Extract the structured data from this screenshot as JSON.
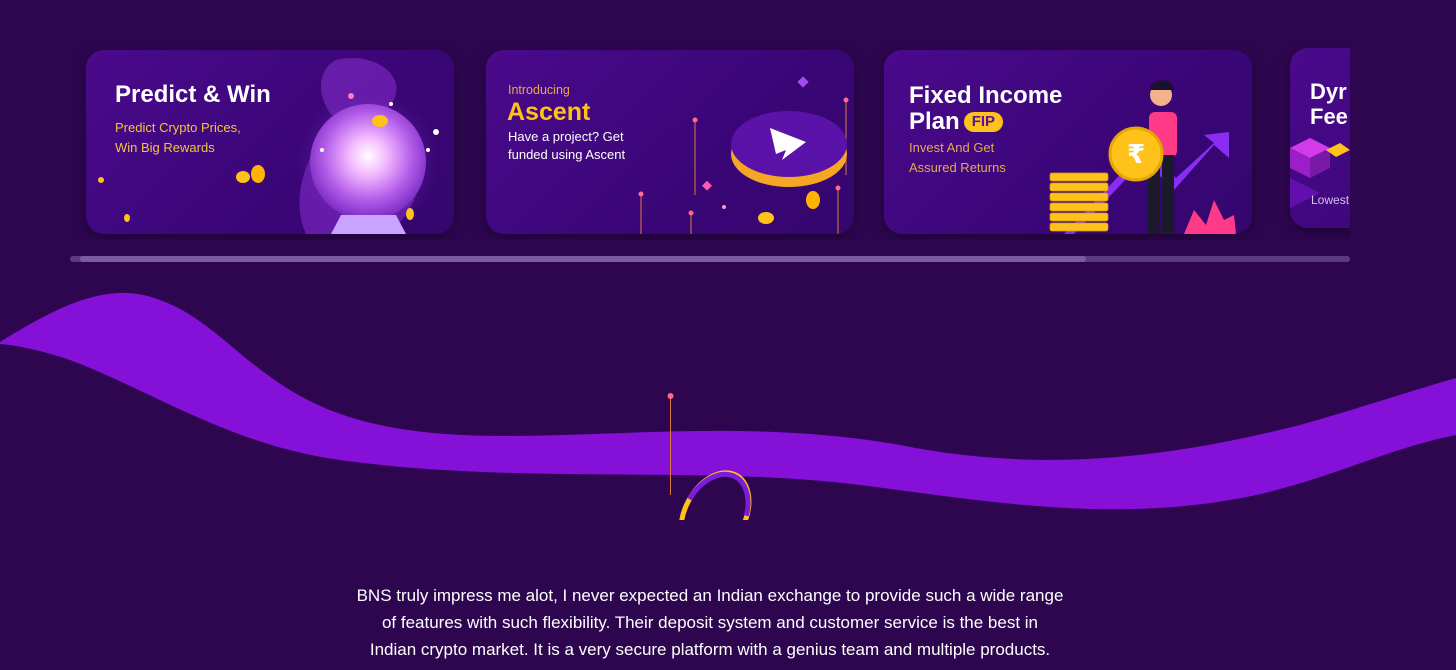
{
  "carousel": {
    "cards": [
      {
        "title": "Predict & Win",
        "subtitle_line1": "Predict Crypto Prices,",
        "subtitle_line2": "Win Big Rewards"
      },
      {
        "intro": "Introducing",
        "title": "Ascent",
        "subtitle_line1": "Have a project? Get",
        "subtitle_line2": "funded using Ascent"
      },
      {
        "title_line1": "Fixed Income",
        "title_line2": "Plan",
        "badge": "FIP",
        "subtitle_line1": "Invest And Get",
        "subtitle_line2": "Assured Returns"
      },
      {
        "title_line1": "Dyr",
        "title_line2": "Fee",
        "subtitle": "Lowest"
      }
    ],
    "scroll_progress": 0.79
  },
  "testimonial": {
    "line1": "BNS truly impress me alot, I never expected an Indian exchange to provide such a wide range",
    "line2": "of features with such flexibility. Their deposit system and customer service is the best in",
    "line3": "Indian crypto market. It is a very secure platform with a genius team and multiple products."
  },
  "colors": {
    "background": "#2e0650",
    "wave": "#8510d8",
    "accent_gold": "#ffc21a"
  }
}
